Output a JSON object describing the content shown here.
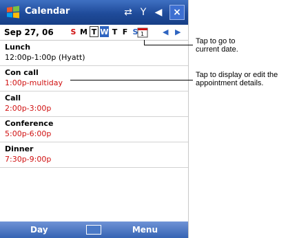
{
  "app": {
    "title": "Calendar"
  },
  "date_bar": {
    "date": "Sep 27, 06",
    "days": [
      "S",
      "M",
      "T",
      "W",
      "T",
      "F",
      "S"
    ]
  },
  "appointments": [
    {
      "title": "Lunch",
      "time": "12:00p-1:00p (Hyatt)"
    },
    {
      "title": "Con call",
      "time": "1:00p-multiday"
    },
    {
      "title": "Call",
      "time": "2:00p-3:00p"
    },
    {
      "title": "Conference",
      "time": "5:00p-6:00p"
    },
    {
      "title": "Dinner",
      "time": "7:30p-9:00p"
    }
  ],
  "softkeys": {
    "left": "Day",
    "right": "Menu"
  },
  "callouts": [
    {
      "line1": "Tap to go to",
      "line2": "current date."
    },
    {
      "line1": "Tap to display or edit the",
      "line2": "appointment details."
    }
  ],
  "colors": {
    "titlebar": "#1f4b9a",
    "weekend_red": "#d01010",
    "accent_blue": "#2e64c0"
  }
}
